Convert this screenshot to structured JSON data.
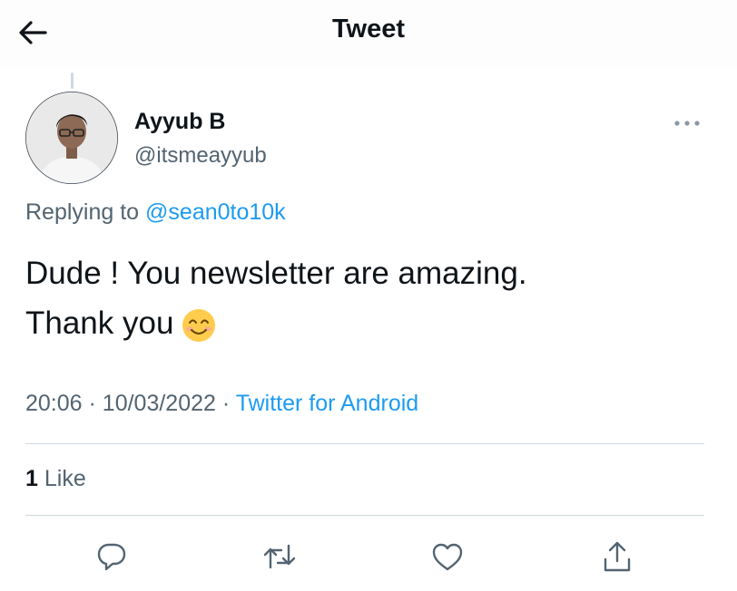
{
  "header": {
    "back_icon": "arrow-left-icon",
    "title": "Tweet"
  },
  "tweet": {
    "author_name": "Ayyub B",
    "author_handle": "@itsmeayyub",
    "more_icon": "more-horizontal-icon",
    "replying_prefix": "Replying to",
    "replying_to": "@sean0to10k",
    "text_line1": "Dude ! You newsletter are amazing.",
    "text_line2": "Thank you",
    "emoji": "smiling-face-icon",
    "time": "20:06",
    "separator": "·",
    "date": "10/03/2022",
    "source": "Twitter for Android"
  },
  "stats": {
    "like_count": "1",
    "like_label": "Like"
  },
  "actions": [
    {
      "icon": "reply-icon"
    },
    {
      "icon": "retweet-icon"
    },
    {
      "icon": "like-icon"
    },
    {
      "icon": "share-icon"
    }
  ],
  "colors": {
    "link": "#1d9bf0",
    "secondary_text": "#536471",
    "divider": "#cfd9de",
    "icon": "#536471"
  }
}
